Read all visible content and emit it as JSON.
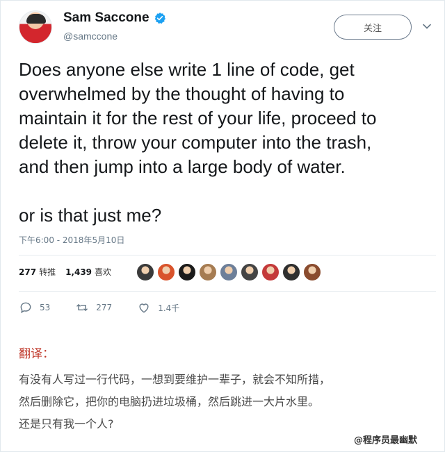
{
  "user": {
    "display_name": "Sam Saccone",
    "handle": "@samccone",
    "verified": true
  },
  "follow_button": {
    "label": "关注"
  },
  "tweet": {
    "text": "Does anyone else write 1 line of code, get\noverwhelmed by the thought of having to\nmaintain it for the rest of your life, proceed to\ndelete it, throw your computer into the trash,\nand then jump into a large body of water.\n\nor is that just me?",
    "timestamp": "下午6:00 - 2018年5月10日"
  },
  "stats": {
    "retweets_count": "277",
    "retweets_label": "转推",
    "likes_count": "1,439",
    "likes_label": "喜欢"
  },
  "liker_avatars": [
    "#3a3a3a",
    "#d9532b",
    "#1b1b1b",
    "#a67c52",
    "#6d7f99",
    "#444444",
    "#c43a3a",
    "#2f2f2f",
    "#8a4b2e"
  ],
  "actions": {
    "reply_count": "53",
    "retweet_count": "277",
    "like_count": "1.4千"
  },
  "translation": {
    "label": "翻译：",
    "lines": [
      "有没有人写过一行代码，一想到要维护一辈子，就会不知所措，",
      "然后删除它，把你的电脑扔进垃圾桶，然后跳进一大片水里。",
      "还是只有我一个人?"
    ]
  },
  "watermark": "@程序员最幽默",
  "colors": {
    "verified_blue": "#1da1f2",
    "secondary_text": "#657786",
    "translation_label": "#c0392b"
  }
}
